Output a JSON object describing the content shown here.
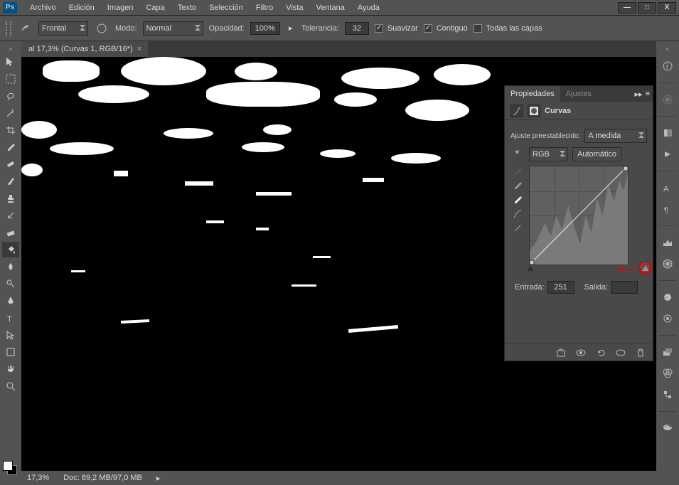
{
  "app": {
    "logo": "Ps"
  },
  "menu": [
    "Archivo",
    "Edición",
    "Imagen",
    "Capa",
    "Texto",
    "Selección",
    "Filtro",
    "Vista",
    "Ventana",
    "Ayuda"
  ],
  "window": {
    "min": "—",
    "max": "□",
    "close": "X"
  },
  "options": {
    "brush_preset": "Frontal",
    "mode_label": "Modo:",
    "mode_value": "Normal",
    "opacity_label": "Opacidad:",
    "opacity_value": "100%",
    "tolerance_label": "Tolerancia:",
    "tolerance_value": "32",
    "antialias": "Suavizar",
    "contiguous": "Contiguo",
    "all_layers": "Todas las capas"
  },
  "doc": {
    "tab_title": "al 17,3% (Curvas 1, RGB/16*)",
    "zoom": "17,3%",
    "docinfo": "Doc: 89,2 MB/97,0 MB"
  },
  "panel": {
    "tab_properties": "Propiedades",
    "tab_adjust": "Ajustes",
    "title": "Curvas",
    "preset_label": "Ajuste preestablecido:",
    "preset_value": "A medida",
    "channel_value": "RGB",
    "auto_btn": "Automático",
    "input_label": "Entrada:",
    "input_value": "251",
    "output_label": "Salida:",
    "output_value": ""
  }
}
